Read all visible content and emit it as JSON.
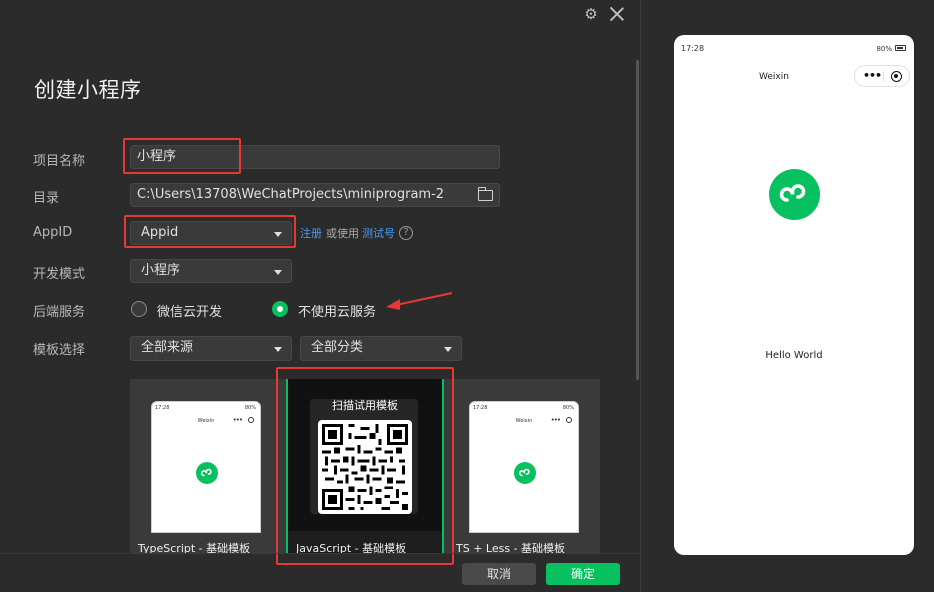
{
  "dialog": {
    "title": "创建小程序",
    "fields": {
      "project_name": {
        "label": "项目名称",
        "value": "小程序"
      },
      "directory": {
        "label": "目录",
        "value": "C:\\Users\\13708\\WeChatProjects\\miniprogram-2"
      },
      "appid": {
        "label": "AppID",
        "value": "Appid",
        "register_link": "注册",
        "or_use": "或使用",
        "test_link": "测试号",
        "help": "?"
      },
      "dev_mode": {
        "label": "开发模式",
        "value": "小程序"
      },
      "backend": {
        "label": "后端服务",
        "options": [
          {
            "label": "微信云开发",
            "selected": false
          },
          {
            "label": "不使用云服务",
            "selected": true
          }
        ]
      },
      "template": {
        "label": "模板选择",
        "source_value": "全部来源",
        "category_value": "全部分类"
      }
    },
    "templates": [
      {
        "label": "TypeScript - 基础模板",
        "selected": false
      },
      {
        "label": "JavaScript - 基础模板",
        "selected": true,
        "scan_title": "扫描试用模板"
      },
      {
        "label": "TS + Less - 基础模板",
        "selected": false
      }
    ],
    "mini_phone": {
      "time": "17:28",
      "battery": "80%",
      "title": "Weixin",
      "dots": "•••"
    },
    "buttons": {
      "cancel": "取消",
      "ok": "确定"
    }
  },
  "preview": {
    "time": "17:28",
    "battery": "80%",
    "title": "Weixin",
    "capsule_dots": "•••",
    "hello": "Hello World"
  },
  "colors": {
    "accent": "#07c160",
    "link": "#4c9bf0",
    "highlight": "#e53935",
    "background": "#2b2b2b"
  },
  "icons": {
    "settings": "gear-icon",
    "close": "close-icon",
    "folder": "folder-icon",
    "help": "help-icon",
    "logo": "miniprogram-logo-icon"
  }
}
